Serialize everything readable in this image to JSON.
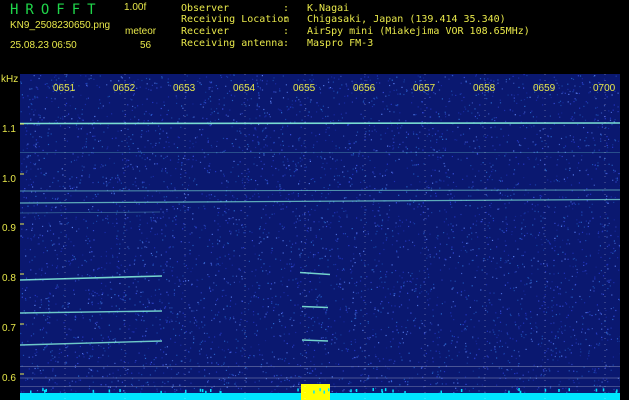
{
  "header": {
    "logo": "HROFFT",
    "version": "1.00f",
    "filename": "KN9_2508230650.png",
    "meteor_label": "meteor",
    "datetime": "25.08.23 06:50",
    "meteor_count": "56",
    "fields": [
      {
        "key": "Observer",
        "value": "K.Nagai"
      },
      {
        "key": "Receiving Location",
        "value": "Chigasaki, Japan (139.414 35.340)"
      },
      {
        "key": "Receiver",
        "value": "AirSpy mini (Miakejima VOR 108.65MHz)"
      },
      {
        "key": "Receiving antenna",
        "value": "Maspro FM-3"
      }
    ]
  },
  "chart_data": {
    "type": "heatmap",
    "ylabel": "kHz",
    "y_ticks": [
      "1.1",
      "1.0",
      "0.9",
      "0.8",
      "0.7",
      "0.6"
    ],
    "x_ticks": [
      "0651",
      "0652",
      "0653",
      "0654",
      "0655",
      "0656",
      "0657",
      "0658",
      "0659",
      "0700"
    ],
    "colors": {
      "background": "#000000",
      "noise": "#1a2ea8",
      "signal": "#7fe8d8",
      "axis": "#e8e84a",
      "burst": "#ffff00",
      "floor": "#00e5ff"
    }
  }
}
